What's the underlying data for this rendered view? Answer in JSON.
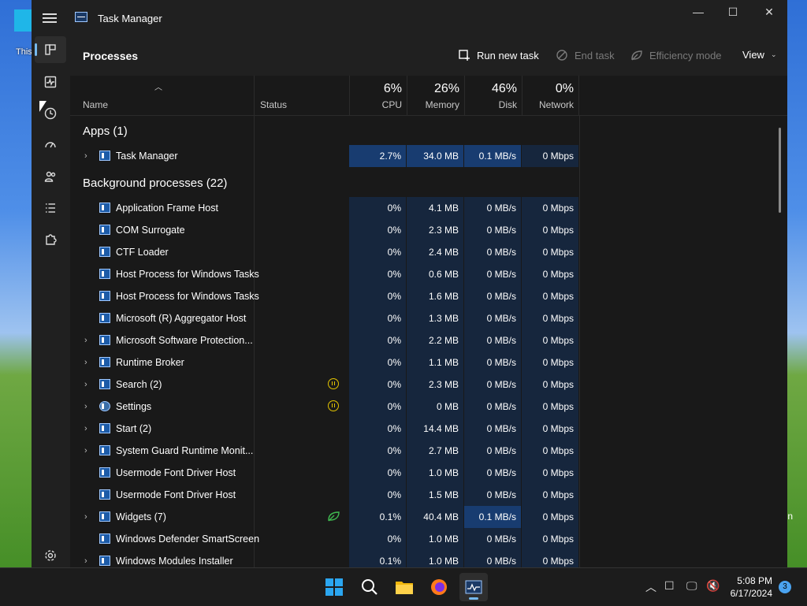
{
  "desktop": {
    "icon_label": "This",
    "right_edge_text": "n"
  },
  "window": {
    "title": "Task Manager",
    "controls": [
      "—",
      "☐",
      "✕"
    ]
  },
  "toolbar": {
    "page_title": "Processes",
    "run_new_task": "Run new task",
    "end_task": "End task",
    "efficiency_mode": "Efficiency mode",
    "view": "View"
  },
  "columns": {
    "name": "Name",
    "status": "Status",
    "cpu": {
      "pct": "6%",
      "label": "CPU"
    },
    "memory": {
      "pct": "26%",
      "label": "Memory"
    },
    "disk": {
      "pct": "46%",
      "label": "Disk"
    },
    "network": {
      "pct": "0%",
      "label": "Network"
    }
  },
  "groups": {
    "apps": "Apps (1)",
    "background": "Background processes (22)"
  },
  "app_rows": [
    {
      "name": "Task Manager",
      "expand": true,
      "cpu": "2.7%",
      "memory": "34.0 MB",
      "disk": "0.1 MB/s",
      "network": "0 Mbps"
    }
  ],
  "bg_rows": [
    {
      "name": "Application Frame Host",
      "expand": false,
      "cpu": "0%",
      "memory": "4.1 MB",
      "disk": "0 MB/s",
      "network": "0 Mbps"
    },
    {
      "name": "COM Surrogate",
      "expand": false,
      "cpu": "0%",
      "memory": "2.3 MB",
      "disk": "0 MB/s",
      "network": "0 Mbps"
    },
    {
      "name": "CTF Loader",
      "expand": false,
      "cpu": "0%",
      "memory": "2.4 MB",
      "disk": "0 MB/s",
      "network": "0 Mbps"
    },
    {
      "name": "Host Process for Windows Tasks",
      "expand": false,
      "cpu": "0%",
      "memory": "0.6 MB",
      "disk": "0 MB/s",
      "network": "0 Mbps"
    },
    {
      "name": "Host Process for Windows Tasks",
      "expand": false,
      "cpu": "0%",
      "memory": "1.6 MB",
      "disk": "0 MB/s",
      "network": "0 Mbps"
    },
    {
      "name": "Microsoft (R) Aggregator Host",
      "expand": false,
      "cpu": "0%",
      "memory": "1.3 MB",
      "disk": "0 MB/s",
      "network": "0 Mbps"
    },
    {
      "name": "Microsoft Software Protection...",
      "expand": true,
      "cpu": "0%",
      "memory": "2.2 MB",
      "disk": "0 MB/s",
      "network": "0 Mbps"
    },
    {
      "name": "Runtime Broker",
      "expand": true,
      "cpu": "0%",
      "memory": "1.1 MB",
      "disk": "0 MB/s",
      "network": "0 Mbps"
    },
    {
      "name": "Search (2)",
      "expand": true,
      "status": "suspended",
      "cpu": "0%",
      "memory": "2.3 MB",
      "disk": "0 MB/s",
      "network": "0 Mbps"
    },
    {
      "name": "Settings",
      "expand": true,
      "status": "suspended",
      "icon": "gear",
      "cpu": "0%",
      "memory": "0 MB",
      "disk": "0 MB/s",
      "network": "0 Mbps"
    },
    {
      "name": "Start (2)",
      "expand": true,
      "cpu": "0%",
      "memory": "14.4 MB",
      "disk": "0 MB/s",
      "network": "0 Mbps"
    },
    {
      "name": "System Guard Runtime Monit...",
      "expand": true,
      "cpu": "0%",
      "memory": "2.7 MB",
      "disk": "0 MB/s",
      "network": "0 Mbps"
    },
    {
      "name": "Usermode Font Driver Host",
      "expand": false,
      "cpu": "0%",
      "memory": "1.0 MB",
      "disk": "0 MB/s",
      "network": "0 Mbps"
    },
    {
      "name": "Usermode Font Driver Host",
      "expand": false,
      "cpu": "0%",
      "memory": "1.5 MB",
      "disk": "0 MB/s",
      "network": "0 Mbps"
    },
    {
      "name": "Widgets (7)",
      "expand": true,
      "status": "efficiency",
      "cpu": "0.1%",
      "memory": "40.4 MB",
      "disk": "0.1 MB/s",
      "network": "0 Mbps",
      "disk_hot": true
    },
    {
      "name": "Windows Defender SmartScreen",
      "expand": false,
      "cpu": "0%",
      "memory": "1.0 MB",
      "disk": "0 MB/s",
      "network": "0 Mbps"
    },
    {
      "name": "Windows Modules Installer",
      "expand": true,
      "cpu": "0.1%",
      "memory": "1.0 MB",
      "disk": "0 MB/s",
      "network": "0 Mbps"
    }
  ],
  "taskbar": {
    "clock_time": "5:08 PM",
    "clock_date": "6/17/2024",
    "notification_count": "3"
  },
  "colors": {
    "accent": "#76b9ed",
    "cell_light": "#16263d",
    "cell_hot": "#183c70",
    "suspended": "#e3c400",
    "efficiency": "#3fb950"
  }
}
